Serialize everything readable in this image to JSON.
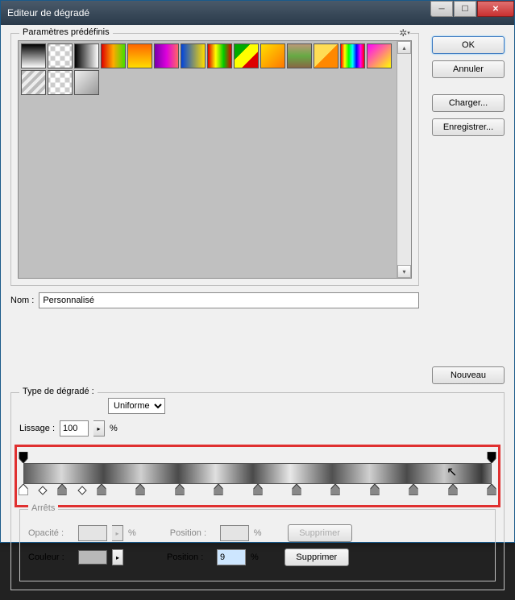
{
  "window": {
    "title": "Editeur de dégradé"
  },
  "buttons": {
    "ok": "OK",
    "cancel": "Annuler",
    "load": "Charger...",
    "save": "Enregistrer...",
    "new": "Nouveau",
    "delete1": "Supprimer",
    "delete2": "Supprimer"
  },
  "presets": {
    "legend": "Paramètres prédéfinis",
    "items": [
      "linear-gradient(to bottom,#000,#fff)",
      "repeating-conic-gradient(#fff 0 25%, #ccc 0 50%) 50% / 12px 12px",
      "linear-gradient(to right,#000,#fff)",
      "linear-gradient(to right,#d00,#fa0,#4d0)",
      "linear-gradient(to bottom,#f60,#fd0)",
      "linear-gradient(to right,#70a,#d0d,#f66)",
      "linear-gradient(to right,#04d,#fd0)",
      "linear-gradient(to right,#d00,#ff0,#0c0,#d00)",
      "linear-gradient(135deg,#0a0 0 33%,#ff0 33% 66%,#d00 66%)",
      "linear-gradient(135deg,#fd0,#f70)",
      "linear-gradient(to bottom,#b97 0%,#6a4 50%,#864 100%)",
      "linear-gradient(135deg,#fd5 0 50%,#f80 50%)",
      "linear-gradient(to right,#f00,#ff0,#0f0,#0ff,#00f,#f0f,#f00)",
      "linear-gradient(135deg,#f0f,#ff0)",
      "repeating-linear-gradient(135deg,#bbb 0 4px,#eee 4px 8px)",
      "repeating-conic-gradient(#fff 0 25%, #ccc 0 50%) 50% / 12px 12px",
      "linear-gradient(135deg,#eee,#999)"
    ]
  },
  "name": {
    "label": "Nom :",
    "value": "Personnalisé"
  },
  "gradtype": {
    "label": "Type de dégradé :",
    "value": "Uniforme"
  },
  "smoothing": {
    "label": "Lissage :",
    "value": "100",
    "unit": "%"
  },
  "gradient_css": "linear-gradient(to right,#5a5a5a 0%,#d8d8d8 8%,#4a4a4a 17%,#d0d0d0 25%,#4a4a4a 33%,#e0e0e0 41%,#4a4a4a 49%,#e8e8e8 57%,#505050 66%,#d0d0d0 74%,#4a4a4a 82%,#c8c8c8 90%,#3a3a3a 98%,#808080 100%)",
  "stops_top": [
    0,
    100
  ],
  "stops_bottom": [
    0,
    8.33,
    16.66,
    25,
    33.33,
    41.66,
    50,
    58.33,
    66.66,
    75,
    83.33,
    91.66,
    100
  ],
  "diamonds": [
    4.2,
    12.5
  ],
  "arrets": {
    "legend": "Arrêts",
    "opacity_label": "Opacité :",
    "opacity_unit": "%",
    "position_label": "Position :",
    "position_unit": "%",
    "color_label": "Couleur :",
    "position_value": "9"
  }
}
